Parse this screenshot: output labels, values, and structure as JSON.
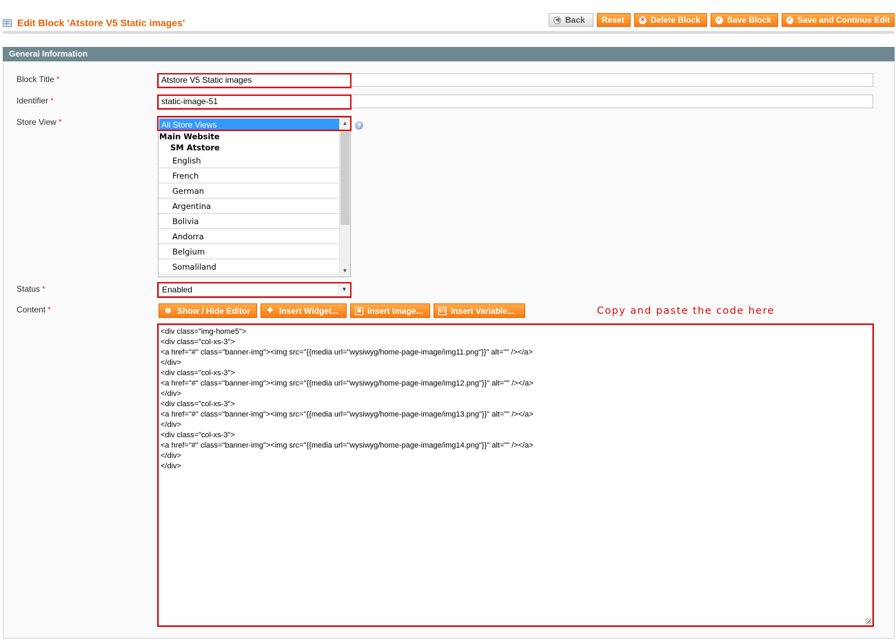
{
  "header": {
    "title": "Edit Block 'Atstore V5 Static images'",
    "buttons": {
      "back": "Back",
      "reset": "Reset",
      "delete": "Delete Block",
      "save": "Save Block",
      "save_continue": "Save and Continue Edit"
    }
  },
  "section": {
    "title": "General Information"
  },
  "form": {
    "block_title": {
      "label": "Block Title",
      "value": "Atstore V5 Static images"
    },
    "identifier": {
      "label": "Identifier",
      "value": "static-image-51"
    },
    "store_view": {
      "label": "Store View",
      "selected": "All Store Views",
      "group": "Main Website",
      "subgroup": "SM Atstore",
      "options": [
        "English",
        "French",
        "German",
        "Argentina",
        "Bolivia",
        "Andorra",
        "Belgium",
        "Somaliland"
      ]
    },
    "status": {
      "label": "Status",
      "value": "Enabled"
    },
    "content": {
      "label": "Content",
      "value": "<div class=\"img-home5\">\n<div class=\"col-xs-3\">\n<a href=\"#\" class=\"banner-img\"><img src=\"{{media url=\"wysiwyg/home-page-image/img11.png\"}}\" alt=\"\" /></a>\n</div>\n<div class=\"col-xs-3\">\n<a href=\"#\" class=\"banner-img\"><img src=\"{{media url=\"wysiwyg/home-page-image/img12.png\"}}\" alt=\"\" /></a>\n</div>\n<div class=\"col-xs-3\">\n<a href=\"#\" class=\"banner-img\"><img src=\"{{media url=\"wysiwyg/home-page-image/img13.png\"}}\" alt=\"\" /></a>\n</div>\n<div class=\"col-xs-3\">\n<a href=\"#\" class=\"banner-img\"><img src=\"{{media url=\"wysiwyg/home-page-image/img14.png\"}}\" alt=\"\" /></a>\n</div>\n</div>"
    },
    "required_mark": "*"
  },
  "editor_buttons": {
    "show_hide": "Show / Hide Editor",
    "insert_widget": "Insert Widget...",
    "insert_image": "Insert Image...",
    "insert_variable": "Insert Variable..."
  },
  "annotation": "Copy and paste the code here",
  "colors": {
    "accent": "#eb5e00",
    "highlight": "#e0070b",
    "section": "#6f8992"
  }
}
